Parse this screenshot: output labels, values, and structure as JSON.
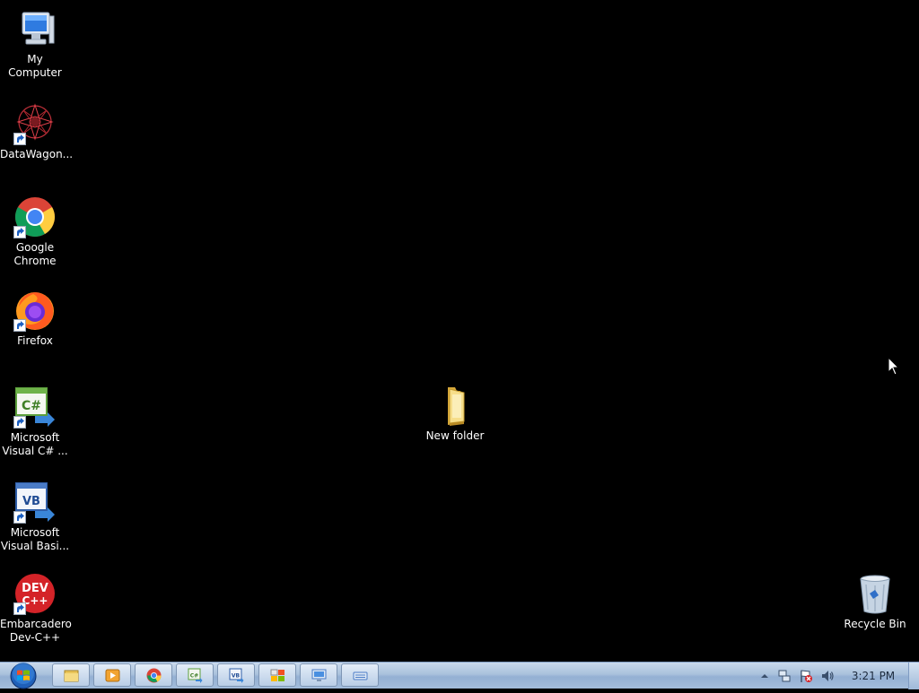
{
  "desktop": {
    "icons": [
      {
        "label": "My Computer"
      },
      {
        "label": "DataWagon..."
      },
      {
        "label": "Google\nChrome"
      },
      {
        "label": "Firefox"
      },
      {
        "label": "Microsoft\nVisual C# ..."
      },
      {
        "label": "Microsoft\nVisual Basi..."
      },
      {
        "label": "Embarcadero\nDev-C++"
      },
      {
        "label": "New folder"
      },
      {
        "label": "Recycle Bin"
      }
    ],
    "background_color": "#000000"
  },
  "taskbar": {
    "clock": "3:21 PM",
    "pinned": [
      "windows-explorer-icon",
      "media-player-icon",
      "chrome-icon",
      "visual-csharp-icon",
      "visual-basic-icon",
      "control-panel-icon",
      "remote-desktop-icon",
      "keyboard-icon"
    ],
    "tray": [
      "show-hidden-icons",
      "network-icon",
      "action-center-icon",
      "volume-icon"
    ]
  },
  "colors": {
    "taskbar_top": "#c9d9ec",
    "taskbar_bottom": "#94b0d3",
    "label_text": "#ffffff"
  }
}
